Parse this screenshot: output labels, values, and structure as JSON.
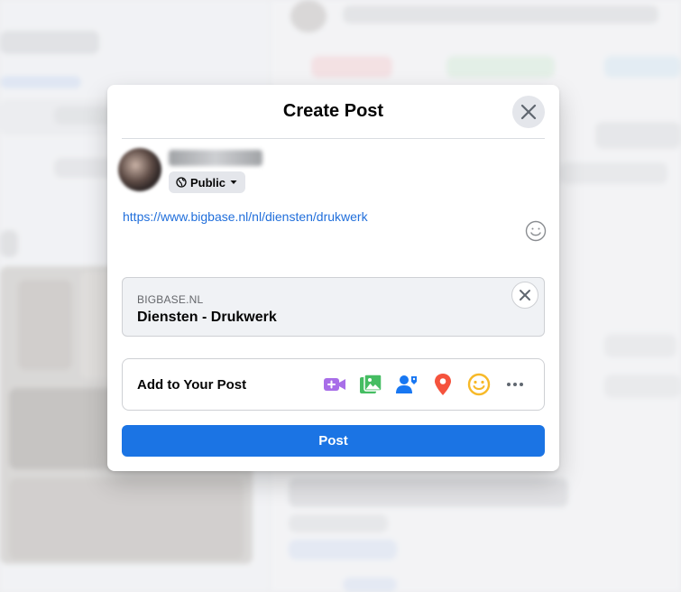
{
  "modal": {
    "title": "Create Post",
    "close_icon": "close-icon"
  },
  "author": {
    "privacy_label": "Public",
    "privacy_icon": "globe-icon"
  },
  "composer": {
    "text": "https://www.bigbase.nl/nl/diensten/drukwerk",
    "emoji_icon": "smiley-icon"
  },
  "link_preview": {
    "domain": "BIGBASE.NL",
    "title": "Diensten - Drukwerk"
  },
  "add_to_post": {
    "label": "Add to Your Post",
    "icons": [
      "live-video-icon",
      "photo-video-icon",
      "tag-people-icon",
      "check-in-icon",
      "feeling-icon",
      "more-icon"
    ]
  },
  "post_button": {
    "label": "Post"
  },
  "colors": {
    "accent": "#1b74e4",
    "link": "#216fdb",
    "live_video": "#f02849",
    "photo": "#45bd62",
    "tag": "#1877f2",
    "location": "#f5533d",
    "feeling": "#f7b928"
  }
}
